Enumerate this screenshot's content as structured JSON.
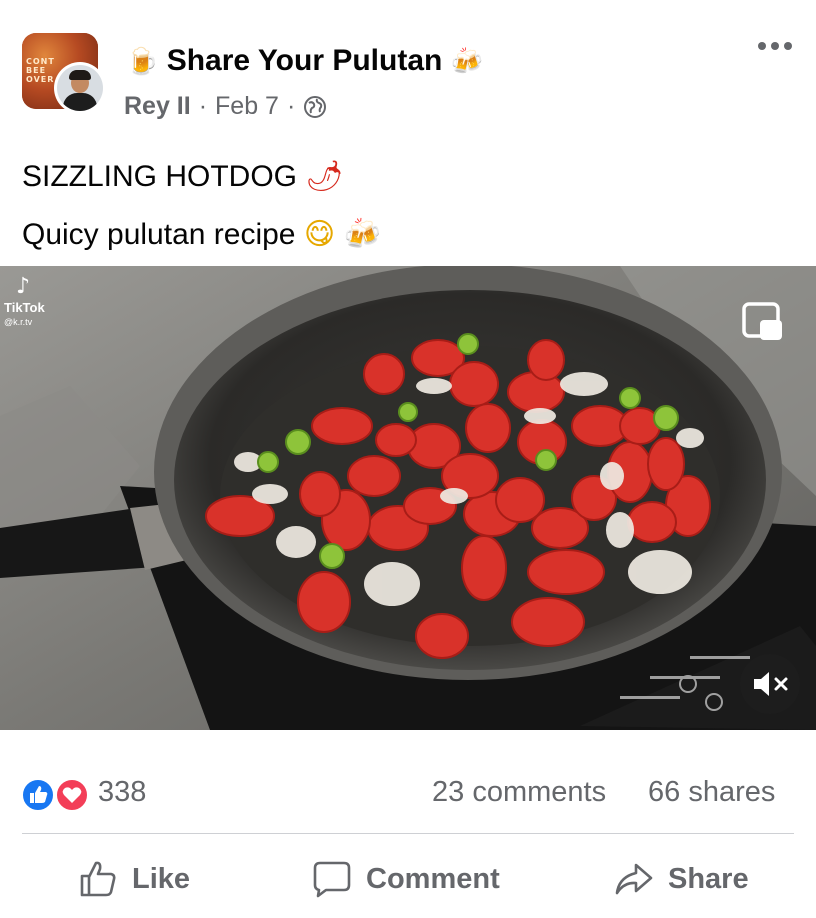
{
  "post": {
    "group_name": "Share Your Pulutan",
    "group_emoji_left": "🍺",
    "group_emoji_right": "🍻",
    "author": "Rey II",
    "separator": "·",
    "date": "Feb 7",
    "caption_line1": "SIZZLING HOTDOG",
    "caption_line1_emoji": "🌶",
    "caption_line2": "Quicy pulutan recipe",
    "caption_line2_emoji1": "😋",
    "caption_line2_emoji2": "🍻",
    "group_avatar_text": "CONT\nBEE\nOVER"
  },
  "video": {
    "watermark_brand": "TikTok",
    "watermark_handle": "@k.r.tv",
    "icons": [
      "tiktok-logo-icon",
      "picture-in-picture-icon",
      "muted-speaker-icon"
    ]
  },
  "stats": {
    "reaction_count": "338",
    "comments": "23 comments",
    "shares": "66 shares",
    "reaction_icons": [
      "like-icon",
      "love-icon"
    ]
  },
  "actions": {
    "like": "Like",
    "comment": "Comment",
    "share": "Share"
  },
  "colors": {
    "text_primary": "#050505",
    "text_secondary": "#65676b",
    "like_blue": "#1877f2",
    "love_red": "#f33e58",
    "divider": "#ced0d4"
  }
}
